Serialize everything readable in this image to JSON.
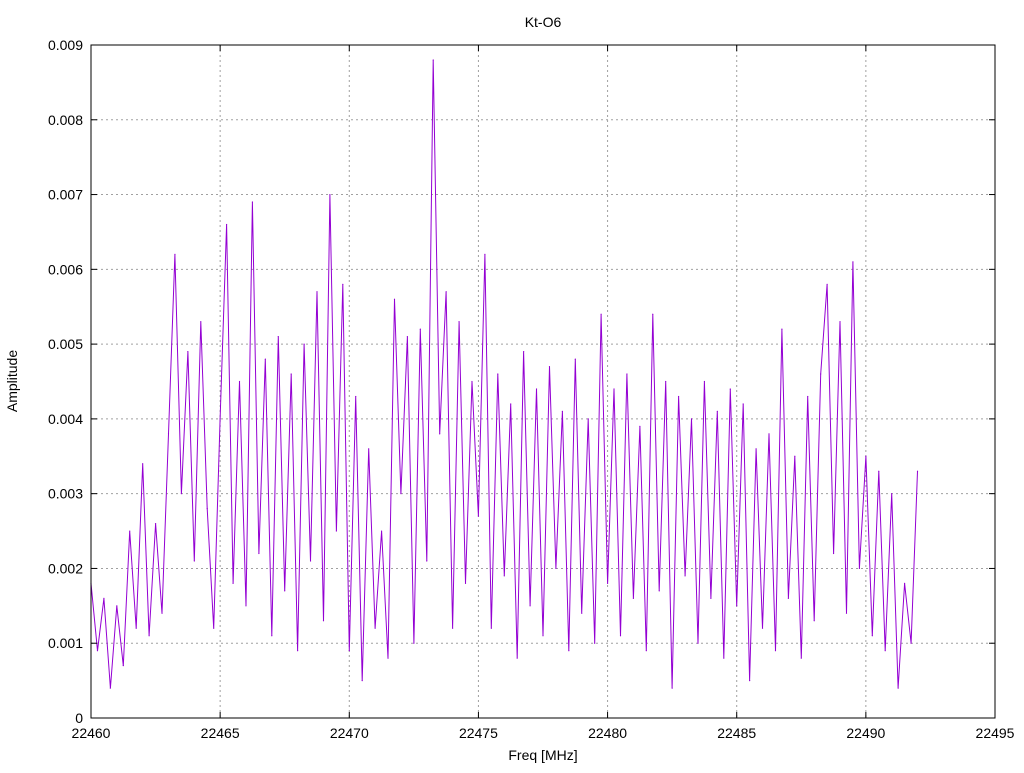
{
  "chart_data": {
    "type": "line",
    "title": "Kt-O6",
    "xlabel": "Freq [MHz]",
    "ylabel": "Amplitude",
    "xlim": [
      22460,
      22495
    ],
    "ylim": [
      0,
      0.009
    ],
    "xticks": [
      "22460",
      "22465",
      "22470",
      "22475",
      "22480",
      "22485",
      "22490",
      "22495"
    ],
    "xtick_values": [
      22460,
      22465,
      22470,
      22475,
      22480,
      22485,
      22490,
      22495
    ],
    "yticks": [
      "0",
      "0.001",
      "0.002",
      "0.003",
      "0.004",
      "0.005",
      "0.006",
      "0.007",
      "0.008",
      "0.009"
    ],
    "ytick_values": [
      0,
      0.001,
      0.002,
      0.003,
      0.004,
      0.005,
      0.006,
      0.007,
      0.008,
      0.009
    ],
    "grid": true,
    "series": [
      {
        "name": "Kt-O6",
        "color": "#9400d3",
        "x_start": 22460,
        "x_step": 0.25,
        "values": [
          0.0018,
          0.0009,
          0.0016,
          0.0004,
          0.0015,
          0.0007,
          0.0025,
          0.0012,
          0.0034,
          0.0011,
          0.0026,
          0.0014,
          0.0038,
          0.0062,
          0.003,
          0.0049,
          0.0021,
          0.0053,
          0.0028,
          0.0012,
          0.004,
          0.0066,
          0.0018,
          0.0045,
          0.0015,
          0.0069,
          0.0022,
          0.0048,
          0.0011,
          0.0051,
          0.0017,
          0.0046,
          0.0009,
          0.005,
          0.0021,
          0.0057,
          0.0013,
          0.007,
          0.0025,
          0.0058,
          0.0009,
          0.0043,
          0.0005,
          0.0036,
          0.0012,
          0.0025,
          0.0008,
          0.0056,
          0.003,
          0.0051,
          0.001,
          0.0052,
          0.0021,
          0.0088,
          0.0038,
          0.0057,
          0.0012,
          0.0053,
          0.0018,
          0.0045,
          0.0027,
          0.0062,
          0.0012,
          0.0046,
          0.0019,
          0.0042,
          0.0008,
          0.0049,
          0.0015,
          0.0044,
          0.0011,
          0.0047,
          0.002,
          0.0041,
          0.0009,
          0.0048,
          0.0014,
          0.004,
          0.001,
          0.0054,
          0.0018,
          0.0044,
          0.0011,
          0.0046,
          0.0016,
          0.0039,
          0.0009,
          0.0054,
          0.0017,
          0.0045,
          0.0004,
          0.0043,
          0.0019,
          0.004,
          0.001,
          0.0045,
          0.0016,
          0.0041,
          0.0008,
          0.0044,
          0.0015,
          0.0042,
          0.0005,
          0.0036,
          0.0012,
          0.0038,
          0.0009,
          0.0052,
          0.0016,
          0.0035,
          0.0008,
          0.0043,
          0.0013,
          0.0046,
          0.0058,
          0.0022,
          0.0053,
          0.0014,
          0.0061,
          0.002,
          0.0035,
          0.0011,
          0.0033,
          0.0009,
          0.003,
          0.0004,
          0.0018,
          0.001,
          0.0033
        ]
      }
    ]
  }
}
